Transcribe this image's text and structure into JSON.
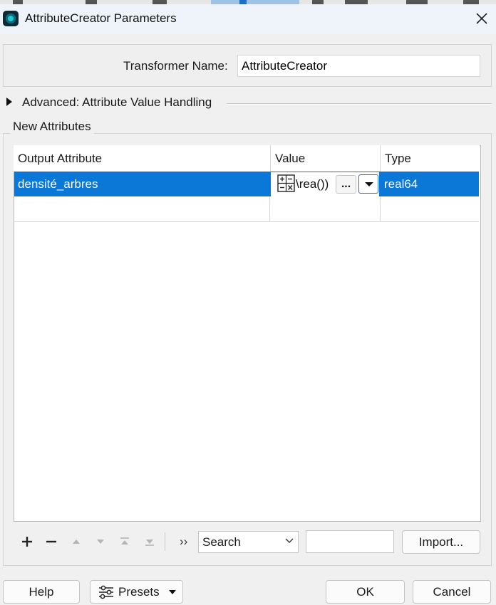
{
  "window": {
    "title": "AttributeCreator Parameters"
  },
  "transformer": {
    "name_label": "Transformer Name:",
    "name_value": "AttributeCreator"
  },
  "advanced": {
    "label": "Advanced: Attribute Value Handling"
  },
  "new_attributes": {
    "group_label": "New Attributes",
    "columns": [
      "Output Attribute",
      "Value",
      "Type"
    ],
    "rows": [
      {
        "output_attribute": "densité_arbres",
        "value": "\\rea())",
        "type": "real64",
        "selected": true
      }
    ],
    "value_more_label": "..."
  },
  "toolbar": {
    "more_label": "››",
    "search_select_value": "Search",
    "search_input_value": "",
    "import_label": "Import..."
  },
  "footer": {
    "help_label": "Help",
    "presets_label": "Presets",
    "ok_label": "OK",
    "cancel_label": "Cancel"
  },
  "colors": {
    "selection": "#0b77d7",
    "dropdown_border": "#1b72c9"
  },
  "icons": [
    "app-icon",
    "close-icon",
    "expand-arrow-icon",
    "calculator-icon",
    "dropdown-arrow-icon",
    "add-icon",
    "remove-icon",
    "move-up-icon",
    "move-down-icon",
    "move-top-icon",
    "move-bottom-icon",
    "chevron-down-icon",
    "presets-sliders-icon"
  ]
}
